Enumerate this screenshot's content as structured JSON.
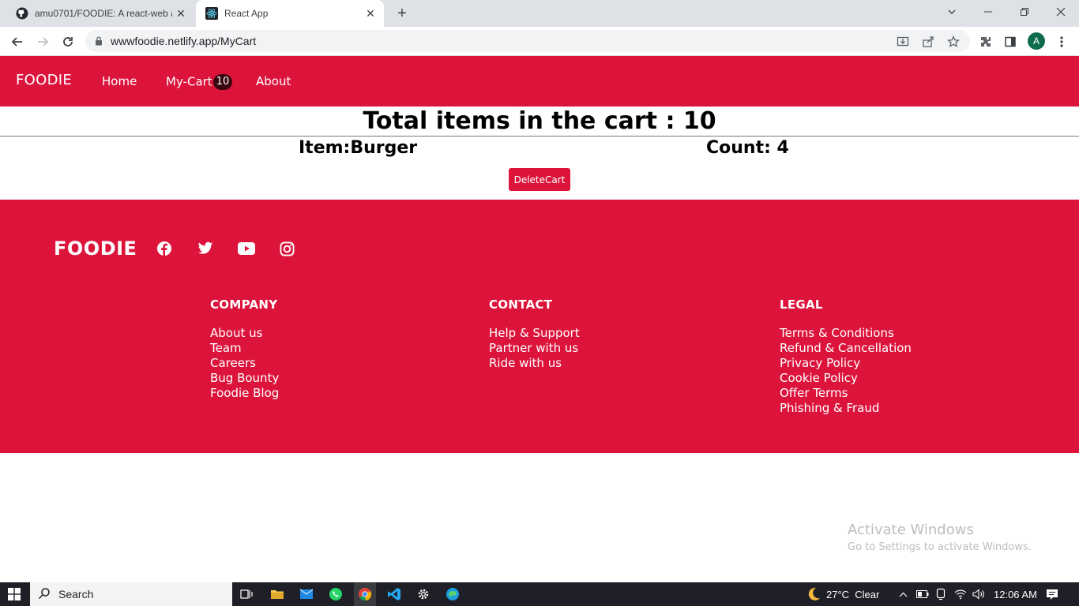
{
  "browser": {
    "tabs": [
      {
        "title": "amu0701/FOODIE: A react-web app",
        "active": false
      },
      {
        "title": "React App",
        "active": true
      }
    ],
    "url": "wwwfoodie.netlify.app/MyCart",
    "avatar_letter": "A"
  },
  "navbar": {
    "brand": "FOODIE",
    "links": {
      "home": "Home",
      "cart": "My-Cart",
      "about": "About"
    },
    "cart_badge": "10"
  },
  "cart": {
    "total_label": "Total items in the cart : 10",
    "item_label": "Item:Burger",
    "count_label": "Count: 4",
    "delete_button": "DeleteCart"
  },
  "footer": {
    "brand": "FOODIE",
    "columns": [
      {
        "heading": "COMPANY",
        "links": [
          "About us",
          "Team",
          "Careers",
          "Bug Bounty",
          "Foodie Blog"
        ]
      },
      {
        "heading": "CONTACT",
        "links": [
          "Help & Support",
          "Partner with us",
          "Ride with us"
        ]
      },
      {
        "heading": "LEGAL",
        "links": [
          "Terms & Conditions",
          "Refund & Cancellation",
          "Privacy Policy",
          "Cookie Policy",
          "Offer Terms",
          "Phishing & Fraud"
        ]
      }
    ]
  },
  "watermark": {
    "line1": "Activate Windows",
    "line2": "Go to Settings to activate Windows."
  },
  "taskbar": {
    "search_label": "Search",
    "weather": "27°C  Clear",
    "time": "12:06 AM"
  },
  "colors": {
    "brand": "#dc143c",
    "badge": "#3a0610"
  }
}
